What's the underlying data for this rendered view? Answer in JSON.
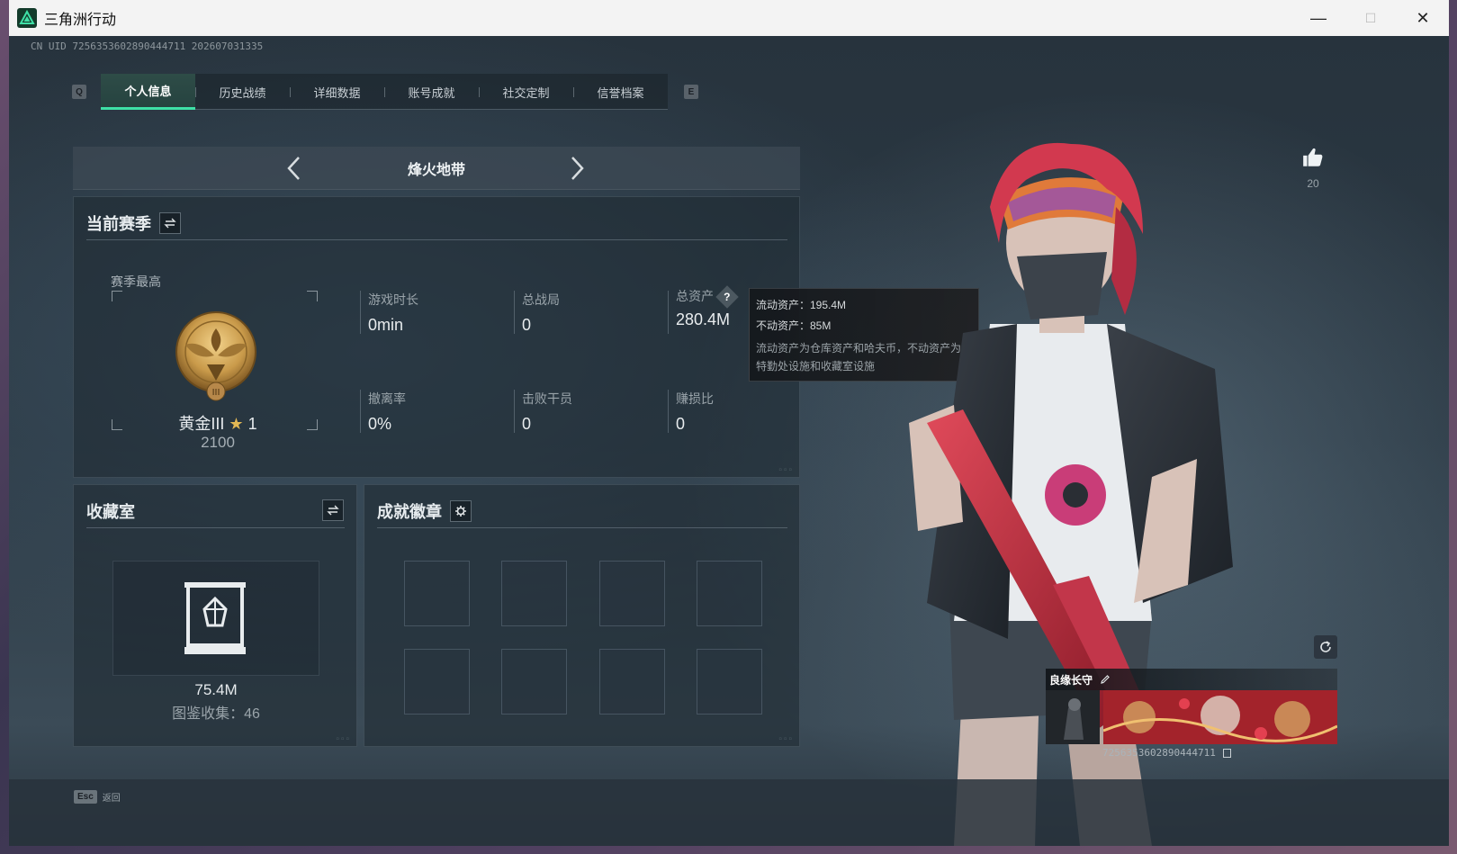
{
  "window": {
    "title": "三角洲行动",
    "minimize": "—",
    "maximize": "☐",
    "close": "✕"
  },
  "uid": "CN UID 7256353602890444711 202607031335",
  "tabs": {
    "left_key": "Q",
    "right_key": "E",
    "items": [
      {
        "label": "个人信息",
        "active": true
      },
      {
        "label": "历史战绩",
        "active": false
      },
      {
        "label": "详细数据",
        "active": false
      },
      {
        "label": "账号成就",
        "active": false
      },
      {
        "label": "社交定制",
        "active": false
      },
      {
        "label": "信誉档案",
        "active": false
      }
    ]
  },
  "mode": {
    "title": "烽火地带",
    "prev_icon": "chevron-left-icon",
    "next_icon": "chevron-right-icon"
  },
  "season": {
    "title": "当前赛季",
    "switch_icon": "swap-icon",
    "best_label": "赛季最高",
    "rank_name": "黄金III",
    "rank_stars": "1",
    "rank_score": "2100",
    "stats": [
      {
        "label": "游戏时长",
        "value": "0min"
      },
      {
        "label": "总战局",
        "value": "0"
      },
      {
        "label": "总资产",
        "value": "280.4M"
      },
      {
        "label": "撤离率",
        "value": "0%"
      },
      {
        "label": "击败干员",
        "value": "0"
      },
      {
        "label": "赚损比",
        "value": "0"
      }
    ],
    "help_icon": "?"
  },
  "tooltip": {
    "liquid": "流动资产：195.4M",
    "fixed": "不动资产：85M",
    "desc_line1": "流动资产为仓库资产和哈夫币，不动资产为",
    "desc_line2": "特勤处设施和收藏室设施"
  },
  "collection": {
    "title": "收藏室",
    "value": "75.4M",
    "catalog": "图鉴收集：46"
  },
  "achievements": {
    "title": "成就徽章",
    "settings_icon": "gear-icon"
  },
  "profile": {
    "like_count": "20",
    "card_name": "良缘长守",
    "card_id": "7256353602890444711"
  },
  "footer": {
    "esc_key": "Esc",
    "back_label": "返回"
  },
  "colors": {
    "accent": "#3ee0a6",
    "gold": "#c99a4a"
  }
}
